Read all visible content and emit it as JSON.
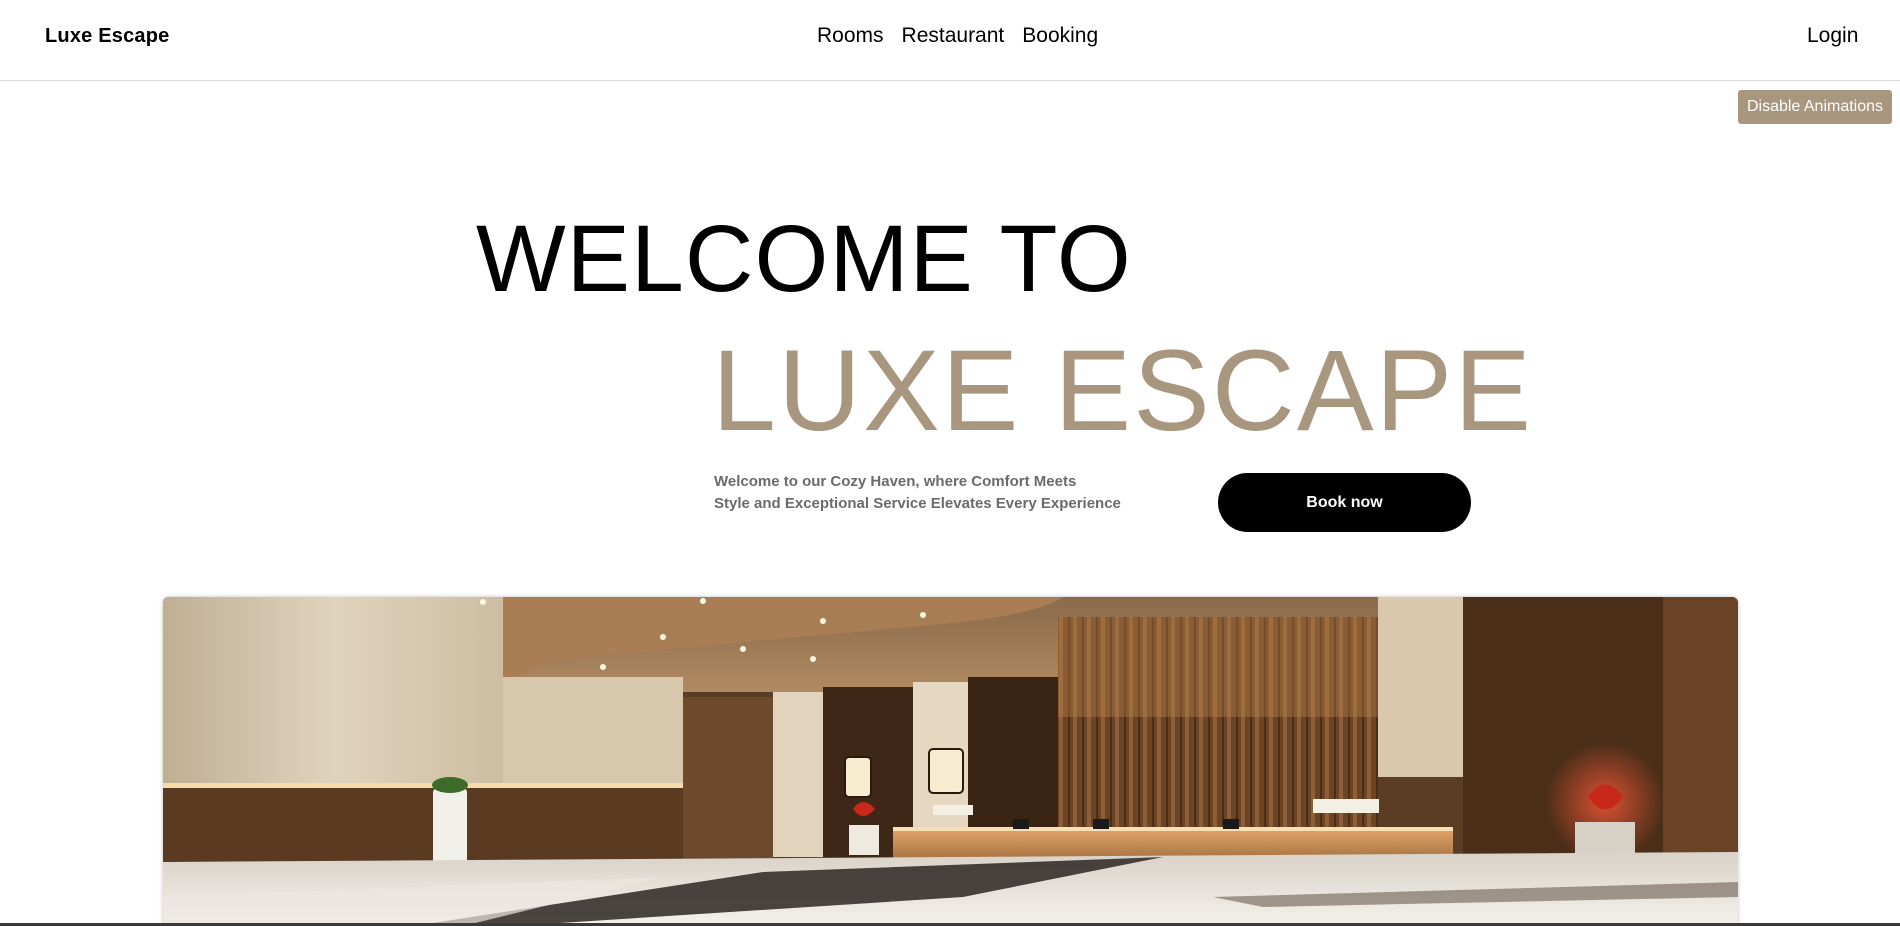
{
  "brand": {
    "name": "Luxe Escape"
  },
  "nav": {
    "links": [
      {
        "label": "Rooms"
      },
      {
        "label": "Restaurant"
      },
      {
        "label": "Booking"
      }
    ],
    "login": "Login"
  },
  "toolbar": {
    "disable_animations": "Disable Animations"
  },
  "hero": {
    "headline_line1": "WELCOME TO",
    "headline_line2": "LUXE ESCAPE",
    "tagline_line1": "Welcome to our Cozy Haven, where Comfort Meets",
    "tagline_line2": "Style and Exceptional Service Elevates Every Experience",
    "cta": "Book now",
    "image_icon": "hotel-lobby-image"
  },
  "colors": {
    "accent": "#a8967e",
    "cta_background": "#000000",
    "tagline": "#6b6b6b",
    "divider": "#d9d9d9"
  }
}
